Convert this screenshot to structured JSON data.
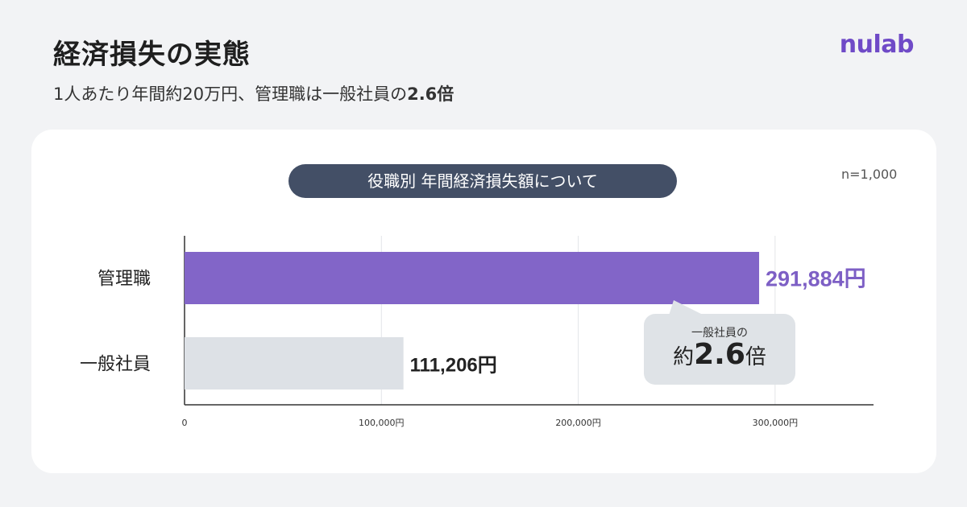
{
  "header": {
    "title": "経済損失の実態",
    "subtitle_text": "1人あたり年間約20万円、管理職は一般社員の",
    "subtitle_emphasis": "2.6倍",
    "logo_text": "nulab"
  },
  "colors": {
    "logo": "#6f4ac7",
    "manager_bar": "#8265c8",
    "general_bar": "#dde1e6",
    "manager_value": "#7d5fc5",
    "title_pill": "#434f66",
    "callout": "#dfe3e7"
  },
  "sample_size": "n=1,000",
  "callout": {
    "line1": "一般社員の",
    "prefix": "約",
    "value": "2.6",
    "suffix": "倍"
  },
  "chart_data": {
    "type": "bar",
    "orientation": "horizontal",
    "title": "役職別 年間経済損失額について",
    "categories": [
      "管理職",
      "一般社員"
    ],
    "values": [
      291884,
      111206
    ],
    "value_labels": [
      "291,884円",
      "111,206円"
    ],
    "x_ticks": [
      {
        "value": 0,
        "label": "0"
      },
      {
        "value": 100000,
        "label": "100,000円"
      },
      {
        "value": 200000,
        "label": "200,000円"
      },
      {
        "value": 300000,
        "label": "300,000円"
      }
    ],
    "xlim": [
      0,
      350000
    ],
    "grid": true,
    "legend": "none"
  }
}
